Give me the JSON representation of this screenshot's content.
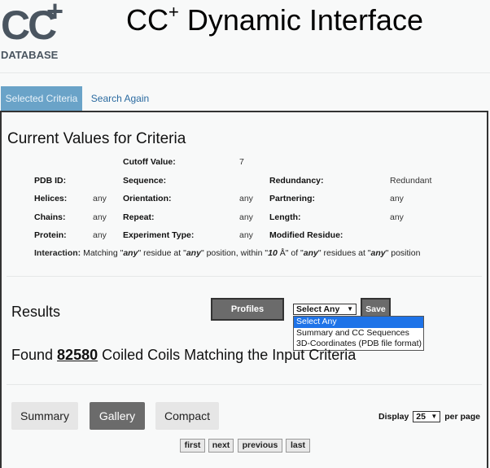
{
  "header": {
    "logo_main": "CC",
    "logo_plus": "+",
    "logo_sub": "DATABASE",
    "title_pre": "CC",
    "title_sup": "+",
    "title_post": " Dynamic Interface"
  },
  "tabs": [
    {
      "label": "Selected Criteria",
      "selected": true
    },
    {
      "label": "Search Again",
      "selected": false
    }
  ],
  "criteria": {
    "heading": "Current Values for Criteria",
    "cutoff_label": "Cutoff Value:",
    "cutoff_value": "7",
    "pdb_label": "PDB ID:",
    "sequence_label": "Sequence:",
    "redundancy_label": "Redundancy:",
    "redundancy_value": "Redundant",
    "helices_label": "Helices:",
    "helices_value": "any",
    "orientation_label": "Orientation:",
    "orientation_value": "any",
    "partnering_label": "Partnering:",
    "partnering_value": "any",
    "chains_label": "Chains:",
    "chains_value": "any",
    "repeat_label": "Repeat:",
    "repeat_value": "any",
    "length_label": "Length:",
    "length_value": "any",
    "protein_label": "Protein:",
    "protein_value": "any",
    "experiment_label": "Experiment Type:",
    "experiment_value": "any",
    "modified_label": "Modified Residue:",
    "interaction": {
      "label": "Interaction:",
      "t1": " Matching \"",
      "v1": "any",
      "t2": "\" residue at \"",
      "v2": "any",
      "t3": "\" position, within \"",
      "v3": "10",
      "t4": " Å\" of \"",
      "v4": "any",
      "t5": "\" residues at \"",
      "v5": "any",
      "t6": "\" position"
    }
  },
  "results": {
    "heading": "Results",
    "profiles_label": "Profiles",
    "save_label": "Save",
    "select_value": "Select Any",
    "dropdown_options": [
      "Select Any",
      "Summary and CC Sequences",
      "3D-Coordinates (PDB file format)"
    ],
    "found_pre": "Found ",
    "found_count": "82580",
    "found_post": " Coiled Coils Matching the Input Criteria"
  },
  "view": {
    "summary_label": "Summary",
    "gallery_label": "Gallery",
    "compact_label": "Compact",
    "display_pre": "Display",
    "per_page_value": "25",
    "display_post": "per page"
  },
  "pagination": {
    "first": "first",
    "next": "next",
    "previous": "previous",
    "last": "last"
  },
  "colors": {
    "tab_selected_bg": "#6aa3c8",
    "dark_button_bg": "#6b6b6b",
    "dropdown_highlight": "#1e73e8",
    "link": "#2a6aa0"
  }
}
